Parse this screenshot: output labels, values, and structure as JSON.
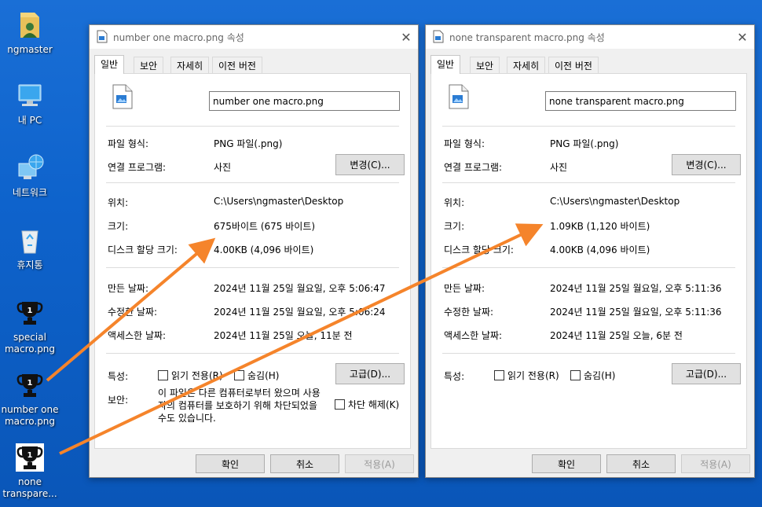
{
  "desktop": {
    "icons": [
      {
        "id": "user",
        "label": "ngmaster",
        "icon": "user-folder-icon"
      },
      {
        "id": "pc",
        "label": "내 PC",
        "icon": "pc-icon"
      },
      {
        "id": "network",
        "label": "네트워크",
        "icon": "network-icon"
      },
      {
        "id": "recycle",
        "label": "휴지통",
        "icon": "recycle-bin-icon"
      },
      {
        "id": "special",
        "label": "special\nmacro.png",
        "icon": "trophy-icon"
      },
      {
        "id": "numberone",
        "label": "number one\nmacro.png",
        "icon": "trophy-icon"
      },
      {
        "id": "none",
        "label": "none\ntranspare...",
        "icon": "trophy-icon"
      }
    ]
  },
  "labels": {
    "file_type": "파일 형식:",
    "open_with": "연결 프로그램:",
    "location": "위치:",
    "size": "크기:",
    "size_on_disk": "디스크 할당 크기:",
    "created": "만든 날짜:",
    "modified": "수정한 날짜:",
    "accessed": "액세스한 날짜:",
    "attributes": "특성:",
    "security": "보안:",
    "readonly": "읽기 전용(R)",
    "hidden": "숨김(H)",
    "change_btn": "변경(C)...",
    "advanced_btn": "고급(D)...",
    "unblock": "차단 해제(K)",
    "ok": "확인",
    "cancel": "취소",
    "apply": "적용(A)"
  },
  "tabs": [
    "일반",
    "보안",
    "자세히",
    "이전 버전"
  ],
  "win1": {
    "title": "number one macro.png 속성",
    "filename": "number one macro.png",
    "file_type": "PNG 파일(.png)",
    "open_with": "사진",
    "location": "C:\\Users\\ngmaster\\Desktop",
    "size": "675바이트 (675 바이트)",
    "size_on_disk": "4.00KB (4,096 바이트)",
    "created": "2024년 11월 25일 월요일, 오후 5:06:47",
    "modified": "2024년 11월 25일 월요일, 오후 5:06:24",
    "accessed": "2024년 11월 25일 오늘, 11분 전",
    "security_text": "이 파일은 다른 컴퓨터로부터 왔으며 사용자의 컴퓨터를 보호하기 위해 차단되었을 수도 있습니다."
  },
  "win2": {
    "title": "none transparent macro.png 속성",
    "filename": "none transparent macro.png",
    "file_type": "PNG 파일(.png)",
    "open_with": "사진",
    "location": "C:\\Users\\ngmaster\\Desktop",
    "size": "1.09KB (1,120 바이트)",
    "size_on_disk": "4.00KB (4,096 바이트)",
    "created": "2024년 11월 25일 월요일, 오후 5:11:36",
    "modified": "2024년 11월 25일 월요일, 오후 5:11:36",
    "accessed": "2024년 11월 25일 오늘, 6분 전"
  },
  "colors": {
    "desktop": "#0e63cc",
    "annotation_arrow": "#f5842b",
    "trophy": "#111111"
  }
}
